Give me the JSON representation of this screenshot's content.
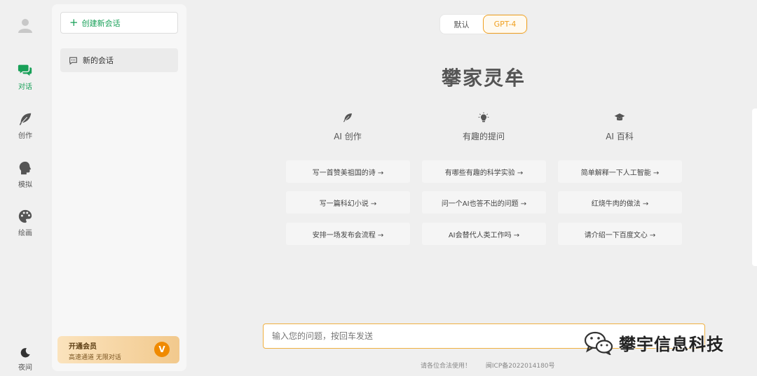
{
  "nav": {
    "items": [
      {
        "label": "对话",
        "icon": "chat-icon",
        "active": true
      },
      {
        "label": "创作",
        "icon": "feather-icon",
        "active": false
      },
      {
        "label": "模拟",
        "icon": "head-profile-icon",
        "active": false
      },
      {
        "label": "绘画",
        "icon": "palette-icon",
        "active": false
      }
    ],
    "night_label": "夜间"
  },
  "sidebar": {
    "new_chat_label": "创建新会话",
    "sessions": [
      {
        "title": "新的会话"
      }
    ],
    "vip": {
      "title": "开通会员",
      "subtitle": "高速通道 无限对话",
      "badge": "V"
    }
  },
  "model_switch": {
    "options": [
      "默认",
      "GPT-4"
    ],
    "selected": "GPT-4"
  },
  "main": {
    "title": "攀家灵牟",
    "categories": [
      {
        "label": "AI 创作",
        "icon": "feather-icon",
        "prompts": [
          "写一首赞美祖国的诗 →",
          "写一篇科幻小说 →",
          "安排一场发布会流程 →"
        ]
      },
      {
        "label": "有趣的提问",
        "icon": "lightbulb-icon",
        "prompts": [
          "有哪些有趣的科学实验 →",
          "问一个AI也答不出的问题 →",
          "AI会替代人类工作吗 →"
        ]
      },
      {
        "label": "AI 百科",
        "icon": "graduation-cap-icon",
        "prompts": [
          "简单解释一下人工智能 →",
          "红烧牛肉的做法 →",
          "请介绍一下百度文心 →"
        ]
      }
    ]
  },
  "input": {
    "placeholder": "输入您的问题，按回车发送",
    "value": ""
  },
  "footer": {
    "notice": "请各位合法使用！",
    "icp": "闽ICP备2022014180号"
  },
  "watermark": {
    "text": "攀宇信息科技"
  },
  "colors": {
    "accent_green": "#18a058",
    "accent_orange": "#f0a020"
  }
}
